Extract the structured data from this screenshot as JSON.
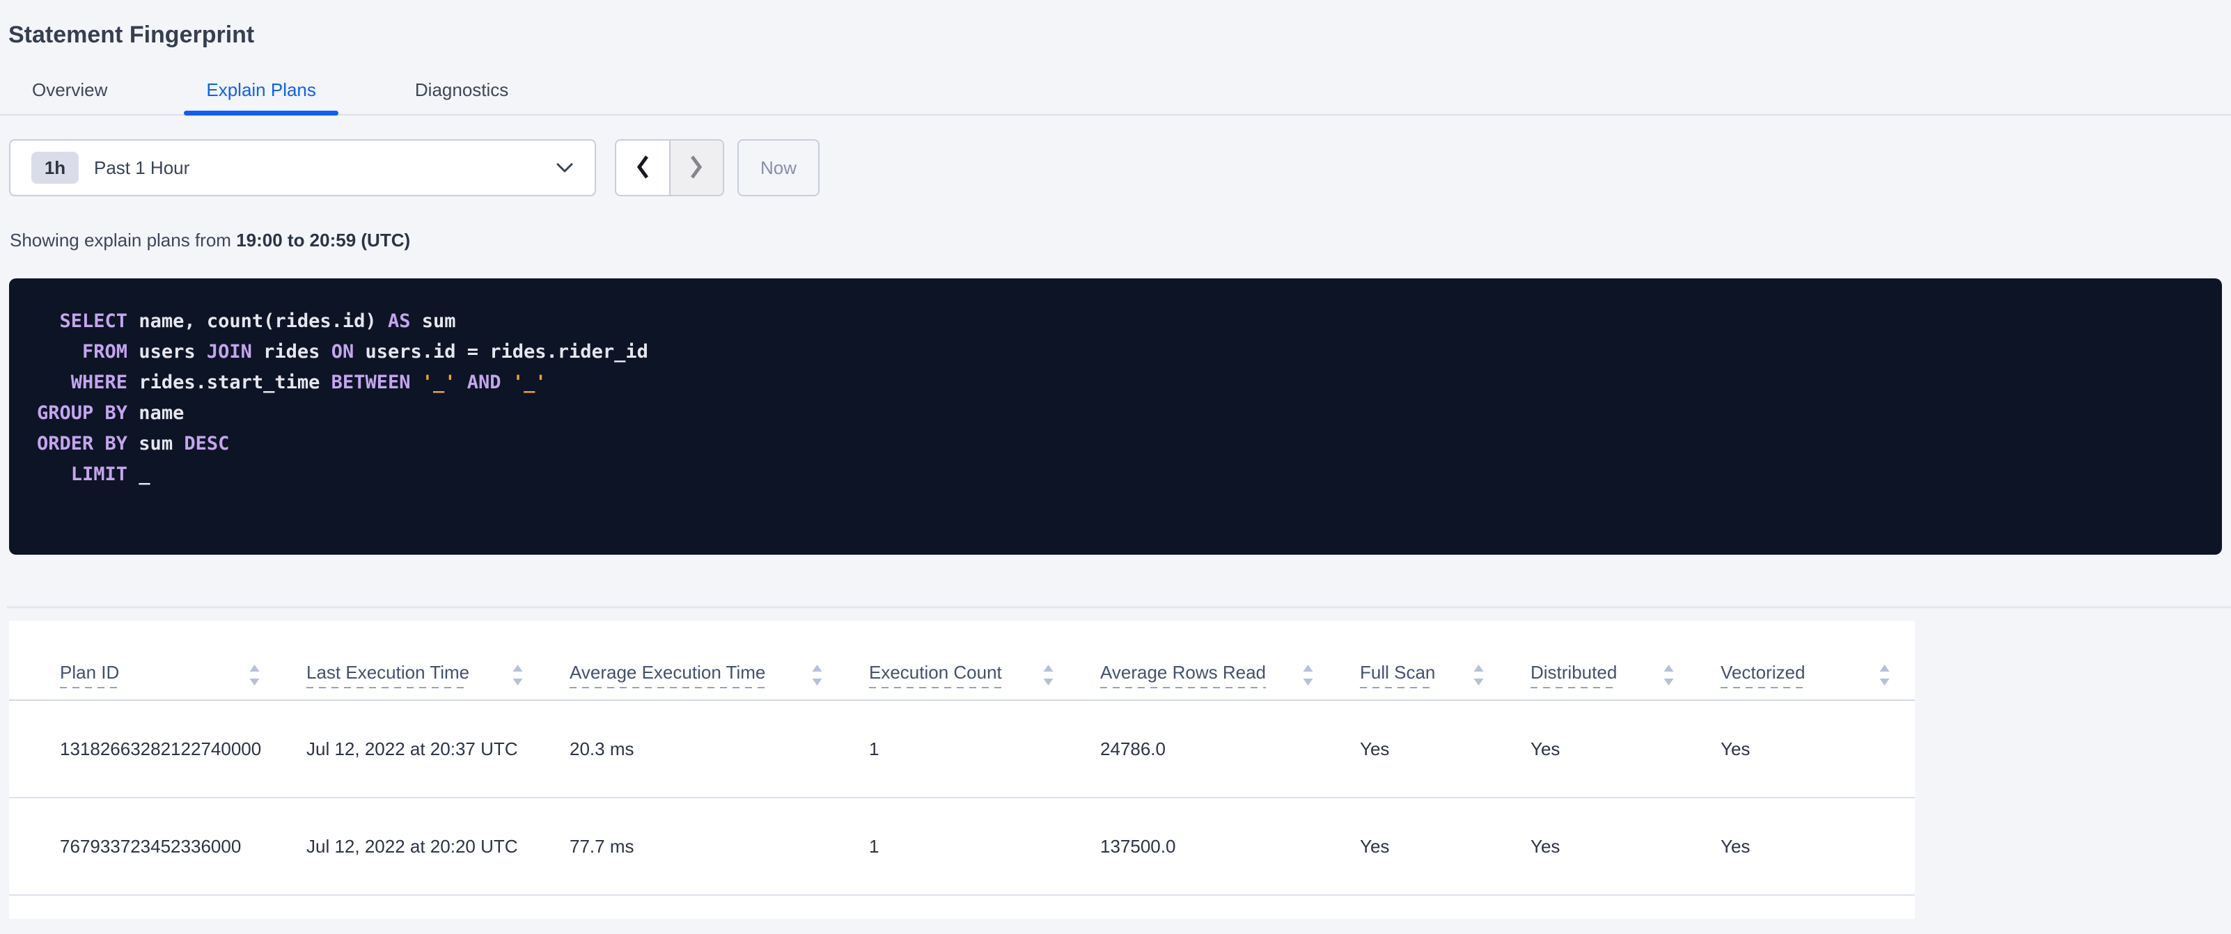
{
  "page_title": "Statement Fingerprint",
  "tabs": {
    "items": [
      {
        "label": "Overview",
        "active": false
      },
      {
        "label": "Explain Plans",
        "active": true
      },
      {
        "label": "Diagnostics",
        "active": false
      }
    ]
  },
  "time_picker": {
    "interval_badge": "1h",
    "selected_label": "Past 1 Hour",
    "now_label": "Now"
  },
  "status_line": {
    "prefix": "Showing explain plans from ",
    "bold_range": "19:00 to 20:59 (UTC)"
  },
  "sql": {
    "lines": [
      [
        [
          "txt",
          "  "
        ],
        [
          "kw",
          "SELECT"
        ],
        [
          "txt",
          " name, count(rides.id) "
        ],
        [
          "kw",
          "AS"
        ],
        [
          "txt",
          " sum"
        ]
      ],
      [
        [
          "txt",
          "    "
        ],
        [
          "kw",
          "FROM"
        ],
        [
          "txt",
          " users "
        ],
        [
          "kw",
          "JOIN"
        ],
        [
          "txt",
          " rides "
        ],
        [
          "kw",
          "ON"
        ],
        [
          "txt",
          " users.id = rides.rider_id"
        ]
      ],
      [
        [
          "txt",
          "   "
        ],
        [
          "kw",
          "WHERE"
        ],
        [
          "txt",
          " rides.start_time "
        ],
        [
          "kw",
          "BETWEEN"
        ],
        [
          "txt",
          " "
        ],
        [
          "lit",
          "'_'"
        ],
        [
          "txt",
          " "
        ],
        [
          "kw",
          "AND"
        ],
        [
          "txt",
          " "
        ],
        [
          "lit",
          "'_'"
        ]
      ],
      [
        [
          "kw",
          "GROUP BY"
        ],
        [
          "txt",
          " name"
        ]
      ],
      [
        [
          "kw",
          "ORDER BY"
        ],
        [
          "txt",
          " sum "
        ],
        [
          "kw",
          "DESC"
        ]
      ],
      [
        [
          "txt",
          "   "
        ],
        [
          "kw",
          "LIMIT"
        ],
        [
          "txt",
          " _"
        ]
      ]
    ]
  },
  "table": {
    "columns": [
      {
        "key": "plan-id",
        "label": "Plan ID",
        "sortable": true
      },
      {
        "key": "last-execution-time",
        "label": "Last Execution Time",
        "sortable": true
      },
      {
        "key": "average-execution-time",
        "label": "Average Execution Time",
        "sortable": true
      },
      {
        "key": "execution-count",
        "label": "Execution Count",
        "sortable": true
      },
      {
        "key": "average-rows-read",
        "label": "Average Rows Read",
        "sortable": true
      },
      {
        "key": "full-scan",
        "label": "Full Scan",
        "sortable": true
      },
      {
        "key": "distributed",
        "label": "Distributed",
        "sortable": true
      },
      {
        "key": "vectorized",
        "label": "Vectorized",
        "sortable": true
      }
    ],
    "rows": [
      [
        "13182663282122740000",
        "Jul 12, 2022 at 20:37 UTC",
        "20.3 ms",
        "1",
        "24786.0",
        "Yes",
        "Yes",
        "Yes"
      ],
      [
        "767933723452336000",
        "Jul 12, 2022 at 20:20 UTC",
        "77.7 ms",
        "1",
        "137500.0",
        "Yes",
        "Yes",
        "Yes"
      ]
    ]
  },
  "colors": {
    "accent_blue": "#0b5fff",
    "page_background": "#f4f5f9",
    "sql_background": "#0d1425",
    "sql_keyword": "#c4a5ee",
    "sql_text": "#e6e6ee",
    "sql_literal": "#efa13b",
    "header_text": "#44516b",
    "body_text": "#2c3444"
  }
}
